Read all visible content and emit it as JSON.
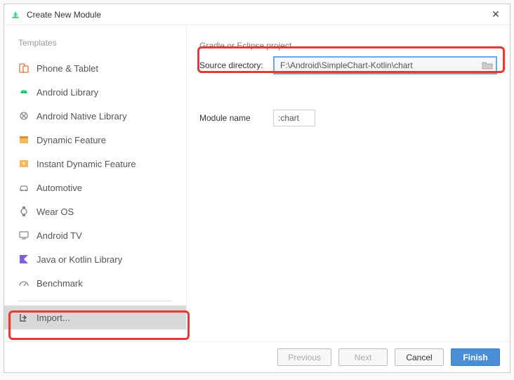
{
  "title": "Create New Module",
  "sidebar": {
    "header": "Templates",
    "items": [
      {
        "label": "Phone & Tablet",
        "icon": "phone-tablet"
      },
      {
        "label": "Android Library",
        "icon": "android"
      },
      {
        "label": "Android Native Library",
        "icon": "native"
      },
      {
        "label": "Dynamic Feature",
        "icon": "dynamic"
      },
      {
        "label": "Instant Dynamic Feature",
        "icon": "instant"
      },
      {
        "label": "Automotive",
        "icon": "auto"
      },
      {
        "label": "Wear OS",
        "icon": "wear"
      },
      {
        "label": "Android TV",
        "icon": "tv"
      },
      {
        "label": "Java or Kotlin Library",
        "icon": "kotlin"
      },
      {
        "label": "Benchmark",
        "icon": "bench"
      }
    ],
    "import_label": "Import..."
  },
  "main": {
    "section_header": "Gradle or Eclipse project",
    "source_label": "Source directory:",
    "source_value": "F:\\Android\\SimpleChart-Kotlin\\chart",
    "module_label": "Module name",
    "module_value": ":chart"
  },
  "footer": {
    "previous": "Previous",
    "next": "Next",
    "cancel": "Cancel",
    "finish": "Finish"
  }
}
